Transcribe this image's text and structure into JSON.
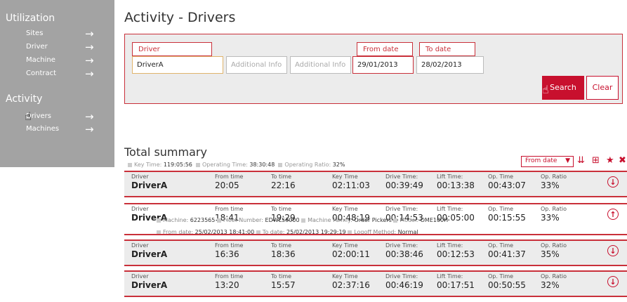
{
  "sidebar": {
    "section1": "Utilization",
    "items1": [
      {
        "label": "Sites",
        "arrow": "→"
      },
      {
        "label": "Driver",
        "arrow": "→"
      },
      {
        "label": "Machine",
        "arrow": "→"
      },
      {
        "label": "Contract",
        "arrow": "→"
      }
    ],
    "section2": "Activity",
    "items2": [
      {
        "label": "Drivers",
        "arrow": "→"
      },
      {
        "label": "Machines",
        "arrow": "→"
      }
    ]
  },
  "page_title": "Activity - Drivers",
  "search": {
    "driver_label": "Driver",
    "driver_value": "DriverA",
    "info1_placeholder": "Additional Info",
    "info2_placeholder": "Additional Info",
    "from_label": "From date",
    "from_value": "29/01/2013",
    "to_label": "To date",
    "to_value": "28/02/2013",
    "search_button": "Search",
    "clear_button": "Clear"
  },
  "summary": {
    "title": "Total summary",
    "key_time_label": "Key Time:",
    "key_time": "119:05:56",
    "op_time_label": "Operating Time:",
    "op_time": "38:30:48",
    "op_ratio_label": "Operating Ratio:",
    "op_ratio": "32%",
    "sort_value": "From date",
    "sort_icon": "sort-desc-icon",
    "add_icon": "plus-square-icon",
    "star_icon": "star-icon",
    "close_icon": "x-icon"
  },
  "columns": {
    "driver": "Driver",
    "from": "From time",
    "to": "To time",
    "key": "Key Time",
    "drive": "Drive Time:",
    "lift": "Lift Time:",
    "op": "Op. Time",
    "ratio": "Op. Ratio"
  },
  "rows": [
    {
      "driver": "DriverA",
      "from": "20:05",
      "to": "22:16",
      "key": "02:11:03",
      "drive": "00:39:49",
      "lift": "00:13:38",
      "op": "00:43:07",
      "ratio": "33%",
      "toggle": "↓"
    },
    {
      "driver": "DriverA",
      "from": "18:41",
      "to": "19:29",
      "key": "00:48:19",
      "drive": "00:14:53",
      "lift": "00:05:00",
      "op": "00:15:55",
      "ratio": "33%",
      "toggle": "↑"
    },
    {
      "driver": "DriverA",
      "from": "16:36",
      "to": "18:36",
      "key": "02:00:11",
      "drive": "00:38:46",
      "lift": "00:12:53",
      "op": "00:41:37",
      "ratio": "35%",
      "toggle": "↓"
    },
    {
      "driver": "DriverA",
      "from": "13:20",
      "to": "15:57",
      "key": "02:37:16",
      "drive": "00:46:19",
      "lift": "00:17:51",
      "op": "00:50:55",
      "ratio": "32%",
      "toggle": "↓"
    }
  ],
  "detail": {
    "from_label": "From date:",
    "from_value": "25/02/2013 18:41:00",
    "to_label": "To date:",
    "to_value": "25/02/2013 19:29:19",
    "logoff_label": "Logoff Method:",
    "logoff_value": "Normal",
    "machine_label": "Machine:",
    "machine_value": "6223565",
    "fleet_label": "Fleet Number:",
    "fleet_value": "EDWL53000",
    "family_label": "Machine Family:",
    "family_value": "Order Pickers",
    "model_label": "Model:",
    "model_value": "OME100H"
  },
  "colors": {
    "accent": "#c8102e",
    "sidebar": "#a3a3a3",
    "panel": "#ececec"
  }
}
